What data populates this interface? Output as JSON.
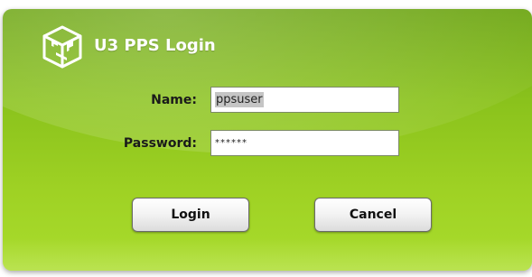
{
  "dialog": {
    "title": "U3 PPS Login",
    "logo_icon": "pps-cube-logo-icon"
  },
  "form": {
    "name_label": "Name:",
    "name_value": "ppsuser",
    "password_label": "Password:",
    "password_value": "******"
  },
  "buttons": {
    "login_label": "Login",
    "cancel_label": "Cancel"
  },
  "colors": {
    "panel_dark": "#6ea615",
    "panel_light": "#a9dc2d",
    "title_text": "#ffffff"
  }
}
